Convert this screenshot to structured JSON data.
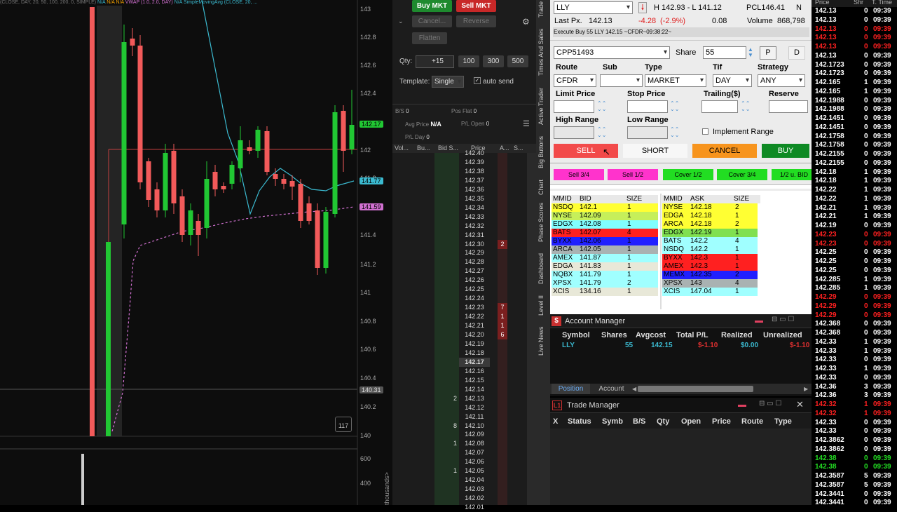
{
  "chart": {
    "header": "(CLOSE, DAY, 20, 50, 100, 200, 0, SIMPLE)",
    "header_tags": [
      "N/A",
      "N/A",
      "N/A",
      "VWAP (1.0, 2.0, DAY)",
      "N/A",
      "SimpleMovingAvg (CLOSE, 20, ..."
    ],
    "price_ticks": [
      "143",
      "142.8",
      "142.6",
      "142.4",
      "142",
      "141.8",
      "141.6",
      "141.4",
      "141.2",
      "141",
      "140.8",
      "140.6",
      "140.4",
      "140.2",
      "140"
    ],
    "badge_last": "142.17",
    "badge_sma": "141.77",
    "badge_vwap": "141.59",
    "badge_low": "140.31",
    "counter": "117",
    "volume_ticks": [
      "600",
      "400"
    ],
    "volume_unit": "thousands>",
    "colors": {
      "up": "#21c733",
      "down": "#f25a5a",
      "sma": "#3bbad0",
      "vwap": "#d070d0"
    }
  },
  "ladder": {
    "buy_mkt": "Buy MKT",
    "sell_mkt": "Sell MKT",
    "cancel": "Cancel...",
    "reverse": "Reverse",
    "flatten": "Flatten",
    "qty_label": "Qty:",
    "qty_value": "+15",
    "qty_presets": [
      "100",
      "300",
      "500"
    ],
    "template_label": "Template:",
    "template_value": "Single",
    "auto_send": "auto send",
    "bs_label": "B/S",
    "bs_value": "0",
    "pos_flat_label": "Pos Flat",
    "pos_flat_value": "0",
    "avg_price_label": "Avg Price",
    "avg_price_value": "N/A",
    "pl_open_label": "P/L Open",
    "pl_open_value": "0",
    "pl_day_label": "P/L Day",
    "pl_day_value": "0",
    "columns": [
      "Vol...",
      "Bu...",
      "Bid S...",
      "Price",
      "A...",
      "S..."
    ],
    "rows": [
      {
        "price": "142.40",
        "bid": "",
        "ask": ""
      },
      {
        "price": "142.39",
        "bid": "",
        "ask": ""
      },
      {
        "price": "142.38",
        "bid": "",
        "ask": ""
      },
      {
        "price": "142.37",
        "bid": "",
        "ask": ""
      },
      {
        "price": "142.36",
        "bid": "",
        "ask": ""
      },
      {
        "price": "142.35",
        "bid": "",
        "ask": ""
      },
      {
        "price": "142.34",
        "bid": "",
        "ask": ""
      },
      {
        "price": "142.33",
        "bid": "",
        "ask": ""
      },
      {
        "price": "142.32",
        "bid": "",
        "ask": ""
      },
      {
        "price": "142.31",
        "bid": "",
        "ask": ""
      },
      {
        "price": "142.30",
        "bid": "",
        "ask": "2"
      },
      {
        "price": "142.29",
        "bid": "",
        "ask": ""
      },
      {
        "price": "142.28",
        "bid": "",
        "ask": ""
      },
      {
        "price": "142.27",
        "bid": "",
        "ask": ""
      },
      {
        "price": "142.26",
        "bid": "",
        "ask": ""
      },
      {
        "price": "142.25",
        "bid": "",
        "ask": ""
      },
      {
        "price": "142.24",
        "bid": "",
        "ask": ""
      },
      {
        "price": "142.23",
        "bid": "",
        "ask": "7"
      },
      {
        "price": "142.22",
        "bid": "",
        "ask": "1"
      },
      {
        "price": "142.21",
        "bid": "",
        "ask": "1"
      },
      {
        "price": "142.20",
        "bid": "",
        "ask": "6"
      },
      {
        "price": "142.19",
        "bid": "",
        "ask": ""
      },
      {
        "price": "142.18",
        "bid": "",
        "ask": ""
      },
      {
        "price": "142.17",
        "bid": "",
        "ask": ""
      },
      {
        "price": "142.16",
        "bid": "",
        "ask": ""
      },
      {
        "price": "142.15",
        "bid": "",
        "ask": ""
      },
      {
        "price": "142.14",
        "bid": "",
        "ask": ""
      },
      {
        "price": "142.13",
        "bid": "2",
        "ask": ""
      },
      {
        "price": "142.12",
        "bid": "",
        "ask": ""
      },
      {
        "price": "142.11",
        "bid": "",
        "ask": ""
      },
      {
        "price": "142.10",
        "bid": "8",
        "ask": ""
      },
      {
        "price": "142.09",
        "bid": "",
        "ask": ""
      },
      {
        "price": "142.08",
        "bid": "1",
        "ask": ""
      },
      {
        "price": "142.07",
        "bid": "",
        "ask": ""
      },
      {
        "price": "142.06",
        "bid": "",
        "ask": ""
      },
      {
        "price": "142.05",
        "bid": "1",
        "ask": ""
      },
      {
        "price": "142.04",
        "bid": "",
        "ask": ""
      },
      {
        "price": "142.03",
        "bid": "",
        "ask": ""
      },
      {
        "price": "142.02",
        "bid": "",
        "ask": ""
      },
      {
        "price": "142.01",
        "bid": "",
        "ask": ""
      }
    ]
  },
  "vtabs": [
    "Trade",
    "Times And Sales",
    "Active Trader",
    "Big Buttons",
    "Chart",
    "Phase Scores",
    "Dashboard",
    "Level II",
    "Live News"
  ],
  "order_entry": {
    "symbol": "LLY",
    "high_low": "H 142.93 - L 141.12",
    "pcl": "PCL146.41",
    "n": "N",
    "last_label": "Last Px.",
    "last_value": "142.13",
    "change": "-4.28",
    "change_pct": "(-2.9%)",
    "change_extra": "0.08",
    "volume_label": "Volume",
    "volume_value": "868,798",
    "exec_msg": "Execute Buy 55 LLY 142.15 ~CFDR~09:38:22~",
    "account": "CPP51493",
    "share_label": "Share",
    "share_value": "55",
    "p_btn": "P",
    "d_btn": "D",
    "route_label": "Route",
    "sub_label": "Sub",
    "type_label": "Type",
    "tif_label": "Tif",
    "strategy_label": "Strategy",
    "route_value": "CFDR",
    "sub_value": "",
    "type_value": "MARKET",
    "tif_value": "DAY",
    "strategy_value": "ANY",
    "limit_label": "Limit Price",
    "stop_label": "Stop Price",
    "trailing_label": "Trailing($)",
    "reserve_label": "Reserve",
    "high_range_label": "High Range",
    "low_range_label": "Low Range",
    "implement_range": "Implement Range",
    "sell": "SELL",
    "short": "SHORT",
    "cancel": "CANCEL",
    "buy": "BUY",
    "small_buttons": [
      "Sell 3/4",
      "Sell 1/2",
      "Cover 1/2",
      "Cover 3/4",
      "1/2 u. BID"
    ],
    "l2_headers_bid": [
      "MMID",
      "BID",
      "SIZE"
    ],
    "l2_headers_ask": [
      "MMID",
      "ASK",
      "SIZE"
    ],
    "bids": [
      {
        "mmid": "NSDQ",
        "price": "142.1",
        "size": "1",
        "color": "#ffff33"
      },
      {
        "mmid": "NYSE",
        "price": "142.09",
        "size": "1",
        "color": "#c6ef5a"
      },
      {
        "mmid": "EDGX",
        "price": "142.08",
        "size": "1",
        "color": "#80ffff"
      },
      {
        "mmid": "BATS",
        "price": "142.07",
        "size": "4",
        "color": "#ff2020"
      },
      {
        "mmid": "BYXX",
        "price": "142.06",
        "size": "1",
        "color": "#2020ff"
      },
      {
        "mmid": "ARCA",
        "price": "142.05",
        "size": "1",
        "color": "#a9b2b2"
      },
      {
        "mmid": "AMEX",
        "price": "141.87",
        "size": "1",
        "color": "#9fffff"
      },
      {
        "mmid": "EDGA",
        "price": "141.83",
        "size": "1",
        "color": "#e8e8d8"
      },
      {
        "mmid": "NQBX",
        "price": "141.79",
        "size": "1",
        "color": "#a0ffff"
      },
      {
        "mmid": "XPSX",
        "price": "141.79",
        "size": "2",
        "color": "#a0ffff"
      },
      {
        "mmid": "XCIS",
        "price": "134.16",
        "size": "1",
        "color": "#e8e8d8"
      }
    ],
    "asks": [
      {
        "mmid": "NYSE",
        "price": "142.18",
        "size": "2",
        "color": "#ffff33"
      },
      {
        "mmid": "EDGA",
        "price": "142.18",
        "size": "1",
        "color": "#ffff33"
      },
      {
        "mmid": "ARCA",
        "price": "142.18",
        "size": "2",
        "color": "#ffff33"
      },
      {
        "mmid": "EDGX",
        "price": "142.19",
        "size": "1",
        "color": "#80e050"
      },
      {
        "mmid": "BATS",
        "price": "142.2",
        "size": "4",
        "color": "#a0ffff"
      },
      {
        "mmid": "NSDQ",
        "price": "142.2",
        "size": "1",
        "color": "#a0ffff"
      },
      {
        "mmid": "BYXX",
        "price": "142.3",
        "size": "1",
        "color": "#ff2020"
      },
      {
        "mmid": "AMEX",
        "price": "142.3",
        "size": "1",
        "color": "#ff2020"
      },
      {
        "mmid": "MEMX",
        "price": "142.35",
        "size": "2",
        "color": "#2020ff"
      },
      {
        "mmid": "XPSX",
        "price": "143",
        "size": "4",
        "color": "#a9b2b2"
      },
      {
        "mmid": "XCIS",
        "price": "147.04",
        "size": "1",
        "color": "#a0ffff"
      }
    ]
  },
  "account_manager": {
    "title": "Account Manager",
    "columns": [
      "Symbol",
      "Shares",
      "Avgcost",
      "Total P/L",
      "Realized",
      "Unrealized"
    ],
    "row": {
      "symbol": "LLY",
      "shares": "55",
      "avgcost": "142.15",
      "total_pl": "$-1.10",
      "realized": "$0.00",
      "unrealized": "$-1.10"
    },
    "tab_position": "Position",
    "tab_account": "Account"
  },
  "trade_manager": {
    "title": "Trade Manager",
    "columns": [
      "X",
      "Status",
      "Symb",
      "B/S",
      "Qty",
      "Open",
      "Price",
      "Route",
      "Type"
    ]
  },
  "time_sales": {
    "columns": [
      "Price",
      "Shr",
      "T. Time"
    ],
    "rows": [
      {
        "p": "142.13",
        "s": "0",
        "t": "09:39",
        "c": "w"
      },
      {
        "p": "142.13",
        "s": "0",
        "t": "09:39",
        "c": "w"
      },
      {
        "p": "142.13",
        "s": "0",
        "t": "09:39",
        "c": "r"
      },
      {
        "p": "142.13",
        "s": "0",
        "t": "09:39",
        "c": "r"
      },
      {
        "p": "142.13",
        "s": "0",
        "t": "09:39",
        "c": "r"
      },
      {
        "p": "142.13",
        "s": "0",
        "t": "09:39",
        "c": "w"
      },
      {
        "p": "142.1723",
        "s": "0",
        "t": "09:39",
        "c": "w"
      },
      {
        "p": "142.1723",
        "s": "0",
        "t": "09:39",
        "c": "w"
      },
      {
        "p": "142.165",
        "s": "1",
        "t": "09:39",
        "c": "w"
      },
      {
        "p": "142.165",
        "s": "1",
        "t": "09:39",
        "c": "w"
      },
      {
        "p": "142.1988",
        "s": "0",
        "t": "09:39",
        "c": "w"
      },
      {
        "p": "142.1988",
        "s": "0",
        "t": "09:39",
        "c": "w"
      },
      {
        "p": "142.1451",
        "s": "0",
        "t": "09:39",
        "c": "w"
      },
      {
        "p": "142.1451",
        "s": "0",
        "t": "09:39",
        "c": "w"
      },
      {
        "p": "142.1758",
        "s": "0",
        "t": "09:39",
        "c": "w"
      },
      {
        "p": "142.1758",
        "s": "0",
        "t": "09:39",
        "c": "w"
      },
      {
        "p": "142.2155",
        "s": "0",
        "t": "09:39",
        "c": "w"
      },
      {
        "p": "142.2155",
        "s": "0",
        "t": "09:39",
        "c": "w"
      },
      {
        "p": "142.18",
        "s": "1",
        "t": "09:39",
        "c": "w"
      },
      {
        "p": "142.18",
        "s": "1",
        "t": "09:39",
        "c": "w"
      },
      {
        "p": "142.22",
        "s": "1",
        "t": "09:39",
        "c": "w"
      },
      {
        "p": "142.22",
        "s": "1",
        "t": "09:39",
        "c": "w"
      },
      {
        "p": "142.21",
        "s": "1",
        "t": "09:39",
        "c": "w"
      },
      {
        "p": "142.21",
        "s": "1",
        "t": "09:39",
        "c": "w"
      },
      {
        "p": "142.19",
        "s": "0",
        "t": "09:39",
        "c": "w"
      },
      {
        "p": "142.23",
        "s": "0",
        "t": "09:39",
        "c": "r"
      },
      {
        "p": "142.23",
        "s": "0",
        "t": "09:39",
        "c": "r"
      },
      {
        "p": "142.25",
        "s": "0",
        "t": "09:39",
        "c": "w"
      },
      {
        "p": "142.25",
        "s": "0",
        "t": "09:39",
        "c": "w"
      },
      {
        "p": "142.25",
        "s": "0",
        "t": "09:39",
        "c": "w"
      },
      {
        "p": "142.285",
        "s": "1",
        "t": "09:39",
        "c": "w"
      },
      {
        "p": "142.285",
        "s": "1",
        "t": "09:39",
        "c": "w"
      },
      {
        "p": "142.29",
        "s": "0",
        "t": "09:39",
        "c": "r"
      },
      {
        "p": "142.29",
        "s": "0",
        "t": "09:39",
        "c": "r"
      },
      {
        "p": "142.29",
        "s": "0",
        "t": "09:39",
        "c": "r"
      },
      {
        "p": "142.368",
        "s": "0",
        "t": "09:39",
        "c": "w"
      },
      {
        "p": "142.368",
        "s": "0",
        "t": "09:39",
        "c": "w"
      },
      {
        "p": "142.33",
        "s": "1",
        "t": "09:39",
        "c": "w"
      },
      {
        "p": "142.33",
        "s": "1",
        "t": "09:39",
        "c": "w"
      },
      {
        "p": "142.33",
        "s": "0",
        "t": "09:39",
        "c": "w"
      },
      {
        "p": "142.33",
        "s": "1",
        "t": "09:39",
        "c": "w"
      },
      {
        "p": "142.33",
        "s": "0",
        "t": "09:39",
        "c": "w"
      },
      {
        "p": "142.36",
        "s": "3",
        "t": "09:39",
        "c": "w"
      },
      {
        "p": "142.36",
        "s": "3",
        "t": "09:39",
        "c": "w"
      },
      {
        "p": "142.32",
        "s": "1",
        "t": "09:39",
        "c": "r"
      },
      {
        "p": "142.32",
        "s": "1",
        "t": "09:39",
        "c": "r"
      },
      {
        "p": "142.33",
        "s": "0",
        "t": "09:39",
        "c": "w"
      },
      {
        "p": "142.33",
        "s": "0",
        "t": "09:39",
        "c": "w"
      },
      {
        "p": "142.3862",
        "s": "0",
        "t": "09:39",
        "c": "w"
      },
      {
        "p": "142.3862",
        "s": "0",
        "t": "09:39",
        "c": "w"
      },
      {
        "p": "142.38",
        "s": "0",
        "t": "09:39",
        "c": "g"
      },
      {
        "p": "142.38",
        "s": "0",
        "t": "09:39",
        "c": "g"
      },
      {
        "p": "142.3587",
        "s": "5",
        "t": "09:39",
        "c": "w"
      },
      {
        "p": "142.3587",
        "s": "5",
        "t": "09:39",
        "c": "w"
      },
      {
        "p": "142.3441",
        "s": "0",
        "t": "09:39",
        "c": "w"
      },
      {
        "p": "142.3441",
        "s": "0",
        "t": "09:39",
        "c": "w"
      }
    ]
  }
}
